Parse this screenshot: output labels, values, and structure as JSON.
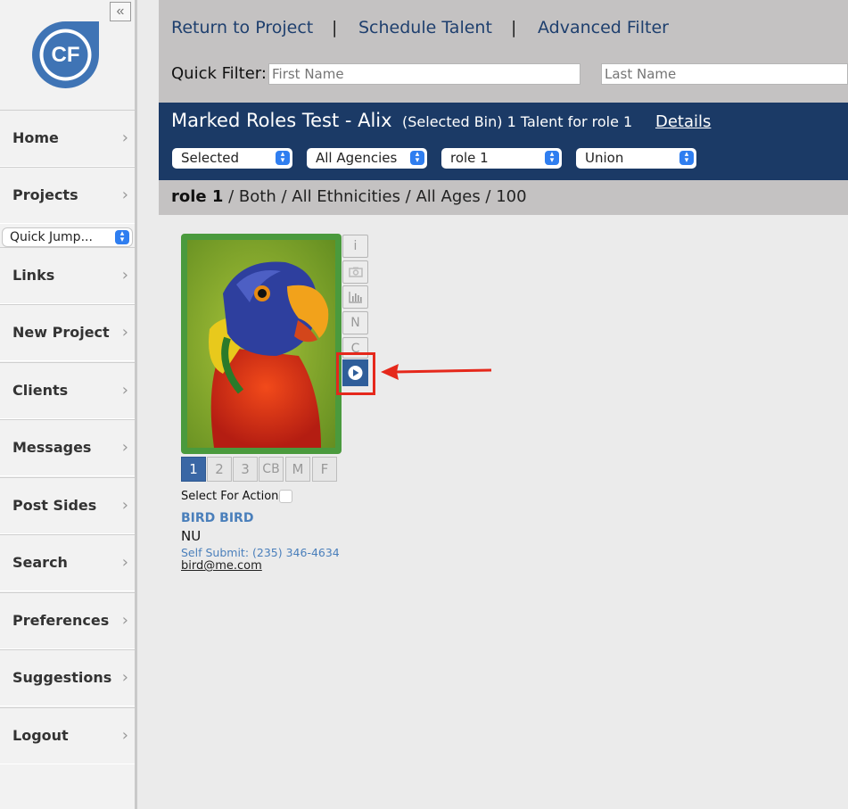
{
  "sidebar": {
    "collapse_glyph": "«",
    "logo_text": "CF",
    "quick_jump": "Quick Jump...",
    "items": [
      {
        "label": "Home"
      },
      {
        "label": "Projects"
      },
      {
        "label": "Links"
      },
      {
        "label": "New Project"
      },
      {
        "label": "Clients"
      },
      {
        "label": "Messages"
      },
      {
        "label": "Post Sides"
      },
      {
        "label": "Search"
      },
      {
        "label": "Preferences"
      },
      {
        "label": "Suggestions"
      },
      {
        "label": "Logout"
      }
    ]
  },
  "topbar": {
    "return_link": "Return to Project",
    "schedule_link": "Schedule Talent",
    "advanced_link": "Advanced Filter",
    "separator": "|",
    "quick_filter_label": "Quick Filter:",
    "first_name_placeholder": "First Name",
    "last_name_placeholder": "Last Name"
  },
  "rolebar": {
    "title": "Marked Roles Test - Alix",
    "subtitle": "(Selected Bin) 1 Talent for role 1",
    "details_link": "Details",
    "filters": {
      "bin": "Selected",
      "agency": "All Agencies",
      "role": "role 1",
      "union": "Union"
    }
  },
  "breadcrumb": {
    "role": "role 1",
    "rest": " / Both / All Ethnicities / All Ages / 100"
  },
  "talent": {
    "side_buttons": {
      "info": "i",
      "notes": "N",
      "comments": "C"
    },
    "tabs": [
      "1",
      "2",
      "3",
      "CB",
      "M",
      "F"
    ],
    "active_tab": "1",
    "select_label": "Select For Actions",
    "name": "BIRD BIRD",
    "union": "NU",
    "submit": "Self Submit: (235) 346-4634",
    "email": "bird@me.com"
  },
  "colors": {
    "header_blue": "#1b3a66",
    "link_blue": "#1e3f6e",
    "photo_border_green": "#4a9a3d",
    "highlight_red": "#e5281b",
    "active_tab_blue": "#3a67a5"
  }
}
